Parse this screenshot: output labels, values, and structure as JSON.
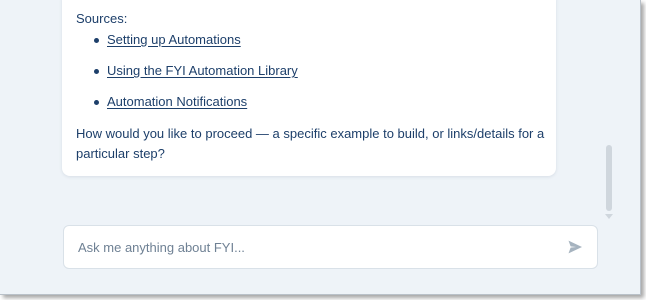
{
  "message": {
    "sources_heading": "Sources:",
    "sources": [
      {
        "label": "Setting up Automations"
      },
      {
        "label": "Using the FYI Automation Library"
      },
      {
        "label": "Automation Notifications"
      }
    ],
    "followup": "How would you like to proceed — a specific example to build, or links/details for a particular step?"
  },
  "input": {
    "placeholder": "Ask me anything about FYI...",
    "value": "",
    "send_icon": "send-icon"
  },
  "colors": {
    "background": "#eef3f8",
    "text": "#1d3f6a",
    "placeholder": "#6f8194",
    "send_icon": "#a6b3bf"
  }
}
